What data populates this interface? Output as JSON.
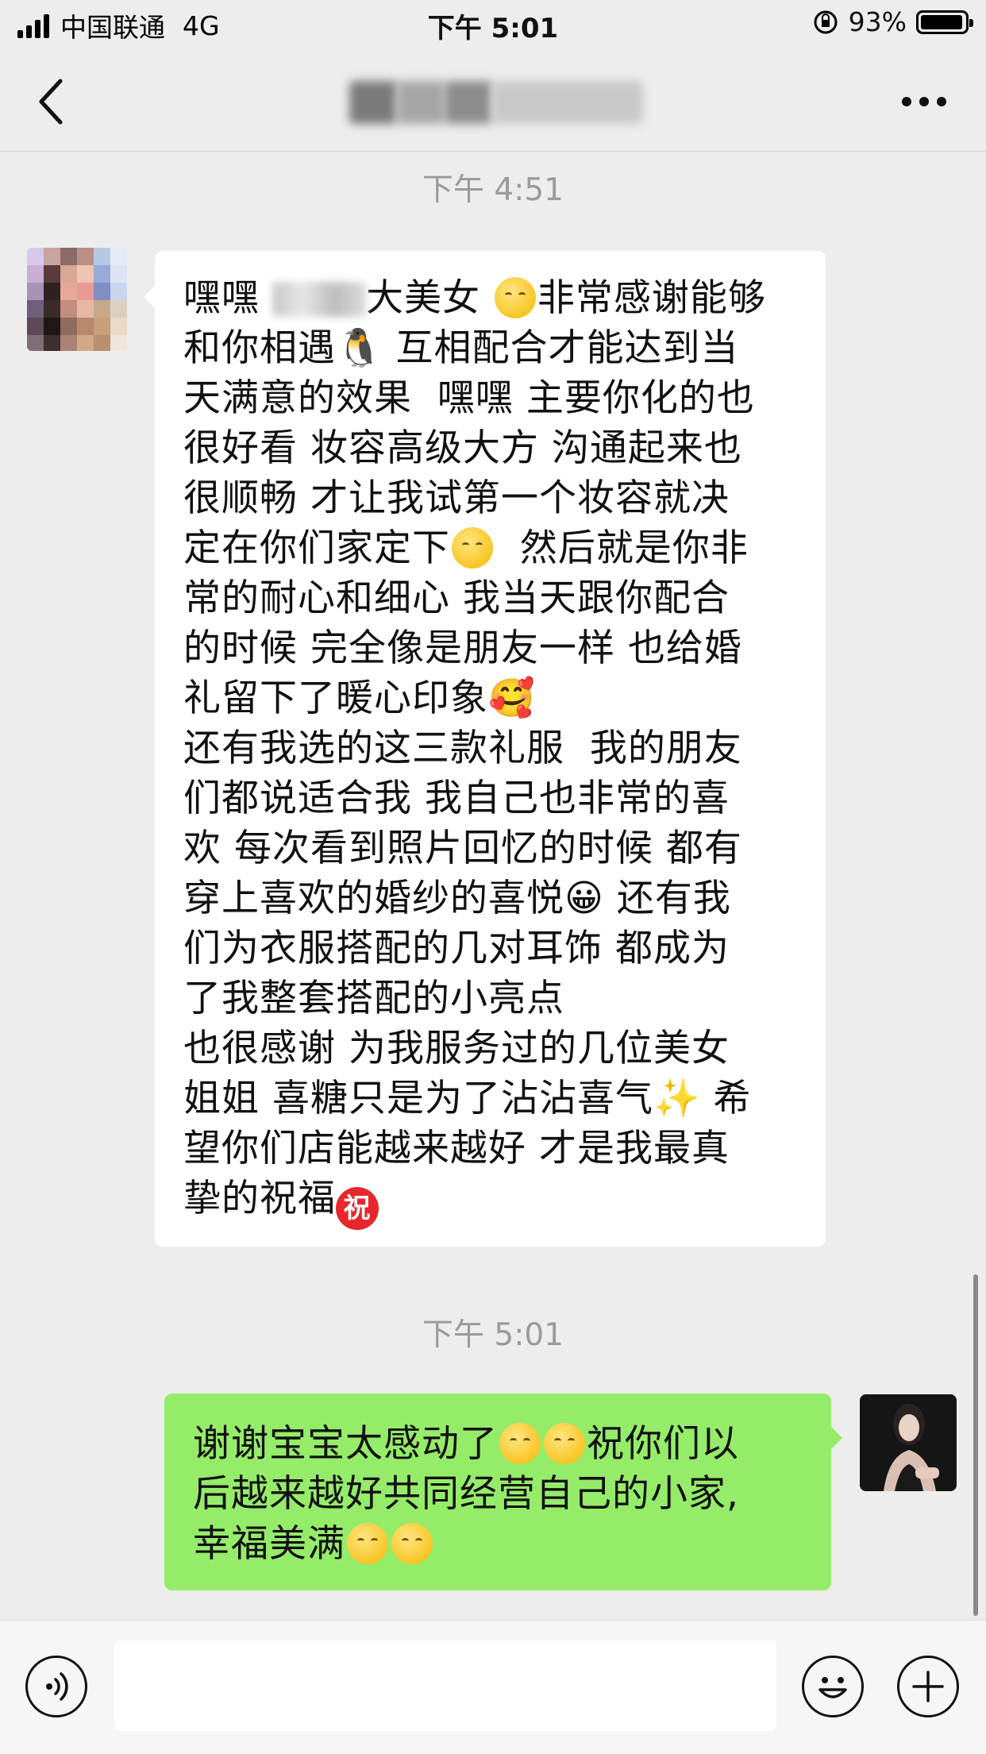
{
  "status_bar": {
    "carrier": "中国联通",
    "network": "4G",
    "time": "下午 5:01",
    "battery": "93%"
  },
  "nav": {
    "title": "",
    "back_icon": "chevron-left-icon",
    "more_icon": "more-horizontal-icon"
  },
  "chat": {
    "timestamp_1": "下午 4:51",
    "timestamp_2": "下午 5:01",
    "incoming": {
      "lines": [
        "嘿嘿",
        "大美女",
        "非常感谢能够",
        "和你相遇🐧 互相配合才能达到当",
        "天满意的效果  嘿嘿 主要你化的也",
        "很好看 妆容高级大方 沟通起来也",
        "很顺畅 才让我试第一个妆容就决",
        "定在你们家定下",
        "  然后就是你非",
        "常的耐心和细心 我当天跟你配合",
        "的时候 完全像是朋友一样 也给婚",
        "礼留下了暖心印象🥰",
        "还有我选的这三款礼服  我的朋友",
        "们都说适合我 我自己也非常的喜",
        "欢 每次看到照片回忆的时候 都有",
        "穿上喜欢的婚纱的喜悦😀 还有我",
        "们为衣服搭配的几对耳饰 都成为",
        "了我整套搭配的小亮点",
        "也很感谢 为我服务过的几位美女",
        "姐姐 喜糖只是为了沾沾喜气✨ 希",
        "望你们店能越来越好 才是我最真",
        "挚的祝福",
        "祝"
      ]
    },
    "outgoing": {
      "line1": "谢谢宝宝太感动了",
      "line1b": "祝你们以",
      "line2": "后越来越好共同经营自己的小家,",
      "line3": "幸福美满"
    }
  },
  "input_bar": {
    "placeholder": "",
    "voice_icon": "voice-icon",
    "emoji_icon": "emoji-icon",
    "plus_icon": "plus-icon"
  },
  "colors": {
    "background": "#ededed",
    "incoming_bubble": "#ffffff",
    "outgoing_bubble": "#95ec69",
    "timestamp": "#9a9a9a"
  }
}
